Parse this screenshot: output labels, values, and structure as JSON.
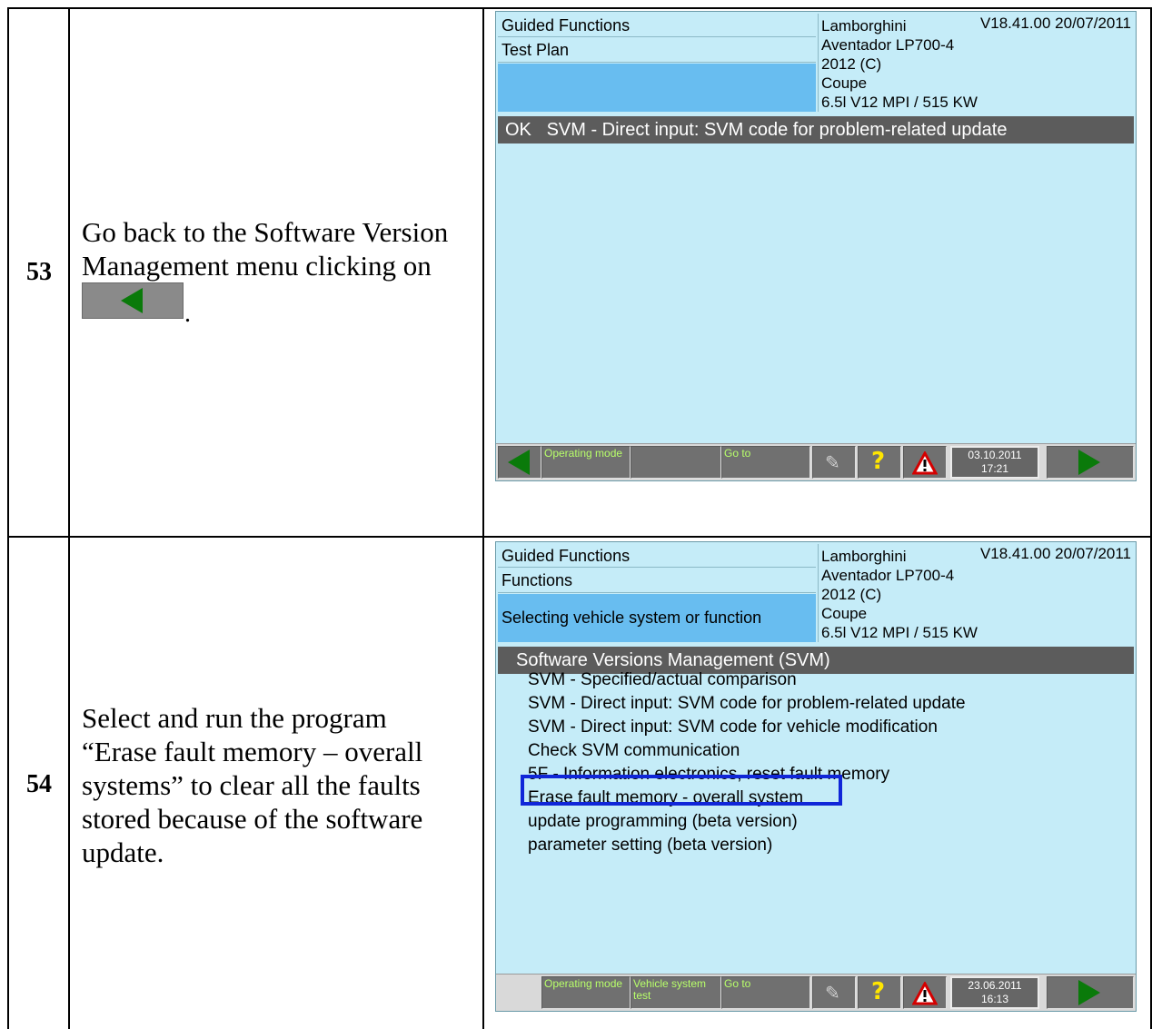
{
  "rows": [
    {
      "step": "53",
      "instruction_lines": [
        "Go back to the Software Version",
        "Management menu clicking on"
      ],
      "instruction_suffix": ".",
      "screen": {
        "header": {
          "line1": "Guided Functions",
          "line2": "Test Plan",
          "line3": "",
          "version": "V18.41.00 20/07/2011",
          "vehicle": [
            "Lamborghini",
            "Aventador LP700-4",
            "2012 (C)",
            "Coupe",
            "6.5l V12 MPI / 515 KW"
          ]
        },
        "title_bar": "OK   SVM - Direct input: SVM code for problem-related update",
        "menu_items": [],
        "toolbar": {
          "btn1": "Operating mode",
          "btn2": "",
          "btn3": "Go to",
          "date": "03.10.2011",
          "time": "17:21"
        }
      }
    },
    {
      "step": "54",
      "instruction_lines": [
        "Select and run the program",
        "“Erase fault memory – overall",
        "systems” to clear all the faults",
        "stored because of the software",
        "update."
      ],
      "screen": {
        "header": {
          "line1": "Guided Functions",
          "line2": "Functions",
          "line3": "Selecting vehicle system or function",
          "version": "V18.41.00 20/07/2011",
          "vehicle": [
            "Lamborghini",
            "Aventador LP700-4",
            "2012 (C)",
            "Coupe",
            "6.5l V12 MPI / 515 KW"
          ]
        },
        "title_bar": "Software Versions Management (SVM)",
        "menu_items": [
          "SVM - Specified/actual comparison",
          "SVM - Direct input: SVM code for problem-related update",
          "SVM - Direct input: SVM code for vehicle modification",
          "Check SVM communication",
          "5F - Information electronics, reset fault memory",
          "Erase fault memory - overall system",
          "update programming (beta version)",
          "parameter setting (beta version)"
        ],
        "toolbar": {
          "btn1": "Operating mode",
          "btn2": "Vehicle system test",
          "btn3": "Go to",
          "date": "23.06.2011",
          "time": "16:13"
        }
      }
    }
  ],
  "colors": {
    "screen_bg": "#c5ecf8",
    "header_highlight": "#68bdf0",
    "title_bar": "#5c5c5c",
    "highlight_box": "#1026d8",
    "arrow_green": "#0a7a0a"
  }
}
